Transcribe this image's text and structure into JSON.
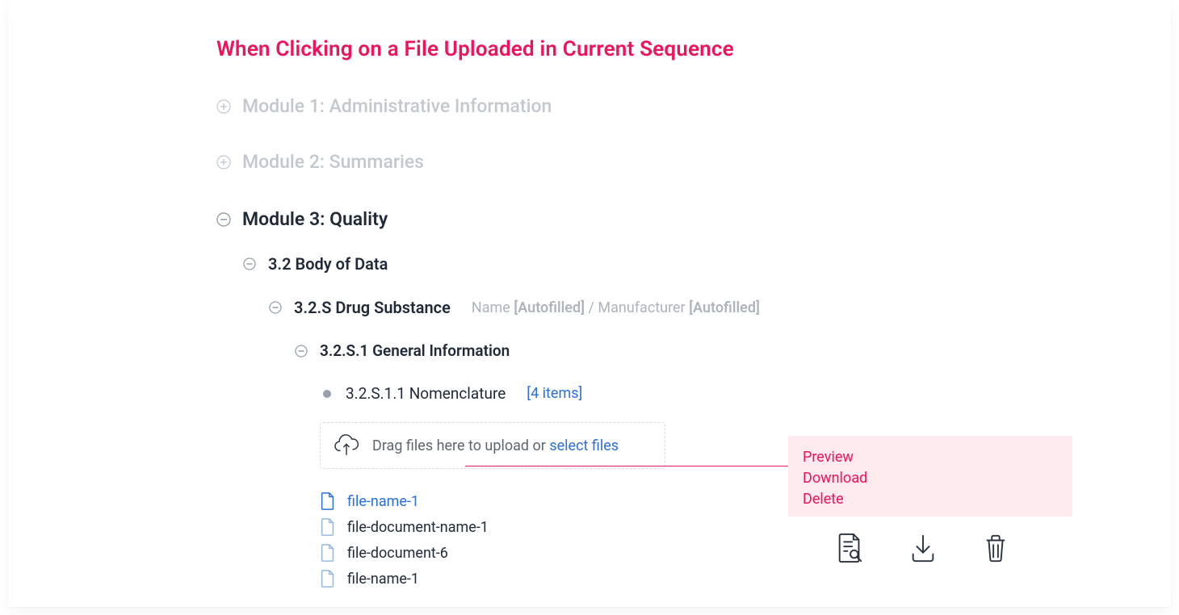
{
  "title": "When Clicking on a File Uploaded in Current Sequence",
  "modules": {
    "m1": "Module 1: Administrative Information",
    "m2": "Module 2: Summaries",
    "m3": "Module 3: Quality"
  },
  "tree": {
    "body_of_data": "3.2 Body of Data",
    "drug_substance": "3.2.S Drug Substance",
    "meta_name_label": "Name ",
    "meta_name_value": "[Autofilled]",
    "meta_sep": " / ",
    "meta_manu_label": "Manufacturer ",
    "meta_manu_value": "[Autofilled]",
    "general_info": "3.2.S.1 General Information",
    "nomenclature": "3.2.S.1.1 Nomenclature",
    "nomenclature_count": "[4 items]"
  },
  "dropzone": {
    "text_prefix": "Drag files here to upload or ",
    "link": "select files"
  },
  "files": [
    {
      "name": "file-name-1",
      "active": true
    },
    {
      "name": "file-document-name-1",
      "active": false
    },
    {
      "name": "file-document-6",
      "active": false
    },
    {
      "name": "file-name-1",
      "active": false
    }
  ],
  "popover": {
    "preview": "Preview",
    "download": "Download",
    "delete": "Delete"
  }
}
